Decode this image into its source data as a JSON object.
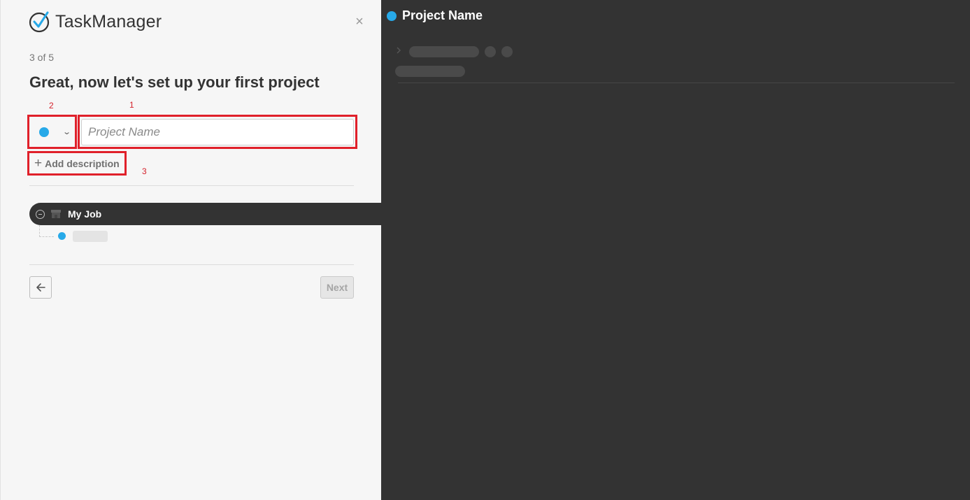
{
  "app": {
    "logo_text": "TaskManager",
    "close_symbol": "×"
  },
  "wizard": {
    "step_text": "3 of 5",
    "heading": "Great, now let's set up your first project",
    "color_picker": {
      "selected_color": "#27a9e8",
      "chevron": "⌄"
    },
    "project_name_input": {
      "placeholder": "Project Name",
      "value": ""
    },
    "add_description": {
      "plus": "+",
      "label": "Add description"
    },
    "hierarchy": {
      "workspace_label": "My Job"
    },
    "navigation": {
      "back_icon": "arrow-left-icon",
      "next_label": "Next"
    }
  },
  "annotations": [
    {
      "number": "1",
      "target": "project-name-input"
    },
    {
      "number": "2",
      "target": "color-picker"
    },
    {
      "number": "3",
      "target": "add-description-button"
    }
  ],
  "preview": {
    "title": "Project Name",
    "dot_color": "#27a9e8"
  },
  "colors": {
    "accent": "#27a9e8",
    "annotation_red": "#e0202a",
    "dark_panel": "#333333"
  }
}
